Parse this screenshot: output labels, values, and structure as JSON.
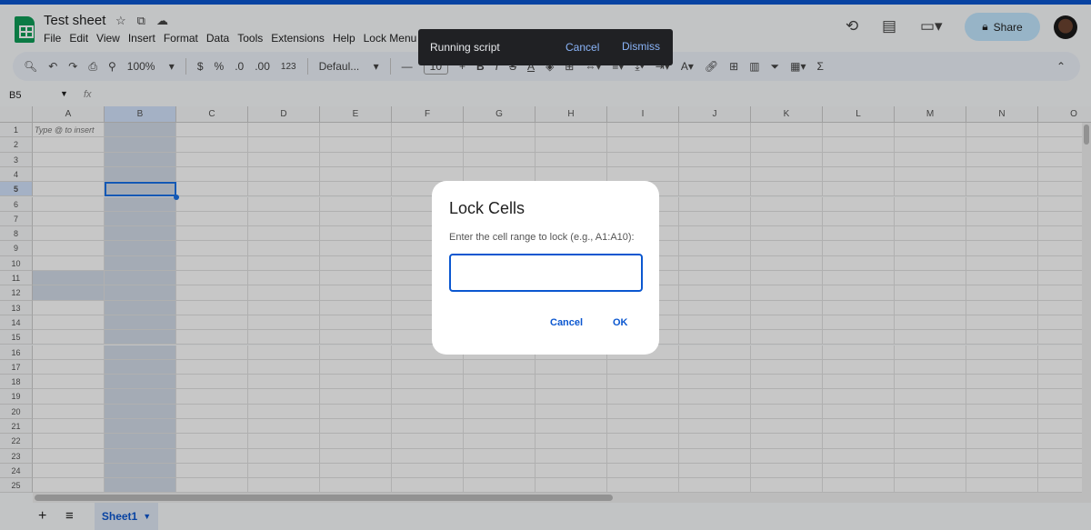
{
  "doc": {
    "title": "Test sheet"
  },
  "menu": [
    "File",
    "Edit",
    "View",
    "Insert",
    "Format",
    "Data",
    "Tools",
    "Extensions",
    "Help",
    "Lock Menu"
  ],
  "share": {
    "label": "Share"
  },
  "toolbar": {
    "zoom": "100%",
    "currency": "$",
    "percent": "%",
    "dec_decrease": ".0",
    "dec_increase": ".00",
    "format_123": "123",
    "font": "Defaul...",
    "font_size": "10"
  },
  "formula_bar": {
    "cell_ref": "B5",
    "fx": "fx"
  },
  "grid": {
    "columns": [
      "A",
      "B",
      "C",
      "D",
      "E",
      "F",
      "G",
      "H",
      "I",
      "J",
      "K",
      "L",
      "M",
      "N",
      "O"
    ],
    "rows": [
      "1",
      "2",
      "3",
      "4",
      "5",
      "6",
      "7",
      "8",
      "9",
      "10",
      "11",
      "12",
      "13",
      "14",
      "15",
      "16",
      "17",
      "18",
      "19",
      "20",
      "21",
      "22",
      "23",
      "24",
      "25"
    ],
    "a1_hint": "Type @ to insert",
    "selected_cell": "B5"
  },
  "sheets": {
    "tab": "Sheet1"
  },
  "toast": {
    "text": "Running script",
    "cancel": "Cancel",
    "dismiss": "Dismiss"
  },
  "dialog": {
    "title": "Lock Cells",
    "label": "Enter the cell range to lock (e.g., A1:A10):",
    "value": "",
    "cancel": "Cancel",
    "ok": "OK"
  },
  "colors": {
    "accent": "#0b57d0",
    "sheets_green": "#0f9d58"
  }
}
